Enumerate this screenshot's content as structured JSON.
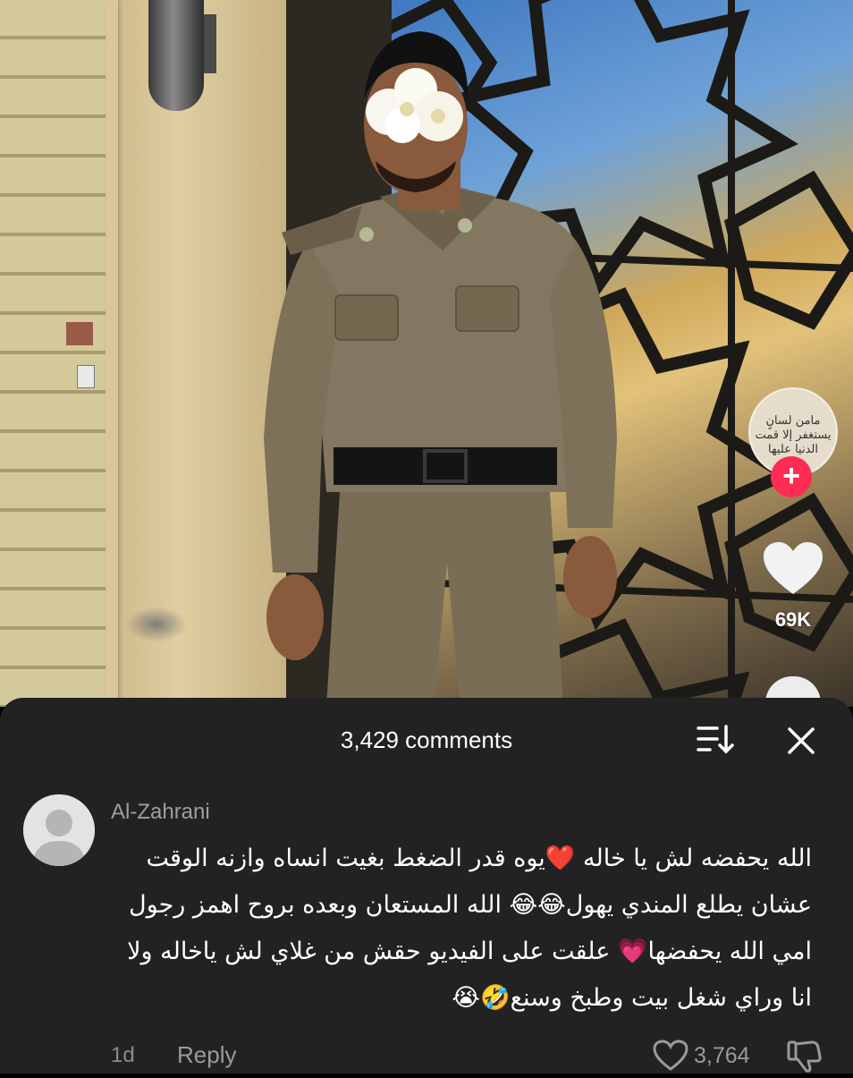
{
  "video": {
    "account_avatar_text": "مامن لسانٍ يستغفر إلا قمت الدنيا عليها",
    "follow_label": "+",
    "like_count": "69K"
  },
  "comments_sheet": {
    "title": "3,429 comments",
    "comment": {
      "username": "Al-Zahrani",
      "lines": [
        "الله يحفضه لش يا خاله ❤️يوه قدر الضغط بغيت انساه وازنه الوقت",
        "عشان يطلع المندي يهول😂😂 الله المستعان وبعده بروح اهمز رجول",
        "امي الله يحفضها💗 علقت على الفيديو حقش من غلاي لش ياخاله ولا",
        "انا وراي شغل بيت وطبخ وسنع🤣😭"
      ],
      "time": "1d",
      "reply_label": "Reply",
      "likes": "3,764"
    }
  },
  "colors": {
    "sheet_bg": "#222222",
    "follow_red": "#fe2c55",
    "meta_gray": "#9a9a9a"
  },
  "icons": [
    "sort-icon",
    "close-icon",
    "heart-icon",
    "dislike-icon",
    "plus-icon",
    "default-avatar-icon"
  ]
}
